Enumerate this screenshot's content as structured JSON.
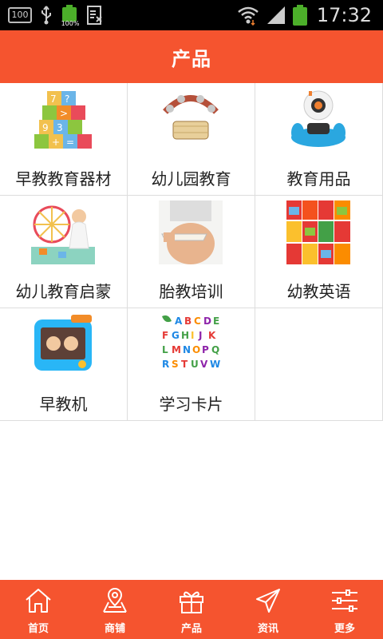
{
  "status_bar": {
    "left_box_text": "100",
    "battery_small_pct": "100%",
    "time": "17:32"
  },
  "header": {
    "title": "产品"
  },
  "products": [
    {
      "label": "早教教育器材",
      "icon": "toy-blocks-image"
    },
    {
      "label": "幼儿园教育",
      "icon": "tambourine-image"
    },
    {
      "label": "教育用品",
      "icon": "robot-toy-image"
    },
    {
      "label": "幼儿教育启蒙",
      "icon": "child-playing-image"
    },
    {
      "label": "胎教培训",
      "icon": "pregnant-belly-image"
    },
    {
      "label": "幼教英语",
      "icon": "book-set-image"
    },
    {
      "label": "早教机",
      "icon": "learning-tablet-image"
    },
    {
      "label": "学习卡片",
      "icon": "alphabet-cards-image"
    }
  ],
  "bottom_nav": [
    {
      "label": "首页",
      "icon": "home-icon"
    },
    {
      "label": "商铺",
      "icon": "map-pin-icon"
    },
    {
      "label": "产品",
      "icon": "gift-icon"
    },
    {
      "label": "资讯",
      "icon": "send-icon"
    },
    {
      "label": "更多",
      "icon": "sliders-icon"
    }
  ],
  "colors": {
    "accent": "#f5542f",
    "status_bar": "#000000",
    "battery": "#4caf2a"
  }
}
